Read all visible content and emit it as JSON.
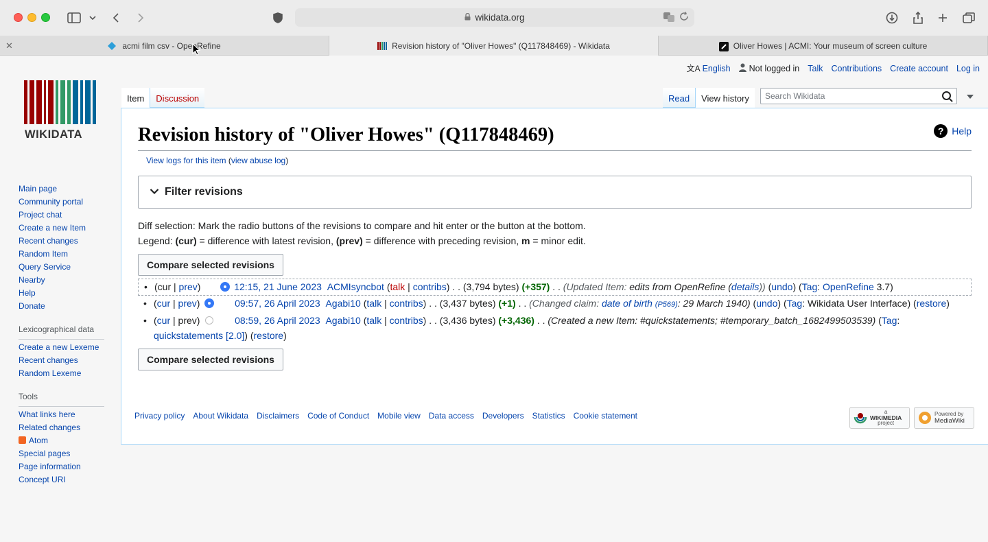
{
  "browser": {
    "url": "wikidata.org",
    "tabs": [
      {
        "label": "acmi film csv - OpenRefine",
        "active": false
      },
      {
        "label": "Revision history of \"Oliver Howes\" (Q117848469) - Wikidata",
        "active": true
      },
      {
        "label": "Oliver Howes | ACMI: Your museum of screen culture",
        "active": false
      }
    ]
  },
  "logo": {
    "text": "WIKIDATA"
  },
  "personal": {
    "language": "English",
    "status": "Not logged in",
    "talk": "Talk",
    "contributions": "Contributions",
    "create_account": "Create account",
    "login": "Log in"
  },
  "nav": {
    "item": "Item",
    "discussion": "Discussion",
    "read": "Read",
    "view_history": "View history",
    "search_placeholder": "Search Wikidata"
  },
  "sidebar": {
    "main": [
      "Main page",
      "Community portal",
      "Project chat",
      "Create a new Item",
      "Recent changes",
      "Random Item",
      "Query Service",
      "Nearby",
      "Help",
      "Donate"
    ],
    "lex_heading": "Lexicographical data",
    "lex": [
      "Create a new Lexeme",
      "Recent changes",
      "Random Lexeme"
    ],
    "tools_heading": "Tools",
    "tools": [
      "What links here",
      "Related changes",
      "Atom",
      "Special pages",
      "Page information",
      "Concept URI"
    ]
  },
  "main": {
    "title": "Revision history of \"Oliver Howes\" (Q117848469)",
    "help": "Help",
    "view_logs": "View logs for this item",
    "view_abuse": "view abuse log",
    "filter": "Filter revisions",
    "diff_line": "Diff selection: Mark the radio buttons of the revisions to compare and hit enter or the button at the bottom.",
    "legend_prefix": "Legend: ",
    "legend_cur": "(cur)",
    "legend_cur_text": " = difference with latest revision, ",
    "legend_prev": "(prev)",
    "legend_prev_text": " = difference with preceding revision, ",
    "legend_m": "m",
    "legend_m_text": " = minor edit.",
    "compare_button": "Compare selected revisions"
  },
  "revisions": [
    {
      "cur": "cur",
      "prev": "prev",
      "date": "12:15, 21 June 2023",
      "user": "ACMIsyncbot",
      "talk": "talk",
      "contribs": "contribs",
      "bytes": "(3,794 bytes)",
      "delta": "(+357)",
      "summary_prefix": "(Updated Item: ",
      "summary": "edits from OpenRefine (",
      "summary_link": "details",
      "summary_suffix": "))",
      "undo": "undo",
      "tag_label": "Tag",
      "tag": "OpenRefine",
      "tag_version": " 3.7"
    },
    {
      "cur": "cur",
      "prev": "prev",
      "date": "09:57, 26 April 2023",
      "user": "Agabi10",
      "talk": "talk",
      "contribs": "contribs",
      "bytes": "(3,437 bytes)",
      "delta": "(+1)",
      "summary_prefix": "(Changed claim: ",
      "summary_link": "date of birth",
      "property": "(P569)",
      "summary_suffix": ": 29 March 1940)",
      "undo": "undo",
      "tag_label": "Tag",
      "tag": "Wikidata User Interface",
      "restore": "restore"
    },
    {
      "cur": "cur",
      "prev": "prev",
      "date": "08:59, 26 April 2023",
      "user": "Agabi10",
      "talk": "talk",
      "contribs": "contribs",
      "bytes": "(3,436 bytes)",
      "delta": "(+3,436)",
      "summary": "(Created a new Item: #quickstatements; #temporary_batch_1682499503539)",
      "tag_label": "Tag",
      "tag": "quickstatements [2.0]",
      "restore": "restore"
    }
  ],
  "footer": [
    "Privacy policy",
    "About Wikidata",
    "Disclaimers",
    "Code of Conduct",
    "Mobile view",
    "Data access",
    "Developers",
    "Statistics",
    "Cookie statement"
  ],
  "badges": {
    "wikimedia_top": "a",
    "wikimedia": "WIKIMEDIA",
    "wikimedia_bottom": "project",
    "mediawiki_top": "Powered by",
    "mediawiki": "MediaWiki"
  }
}
